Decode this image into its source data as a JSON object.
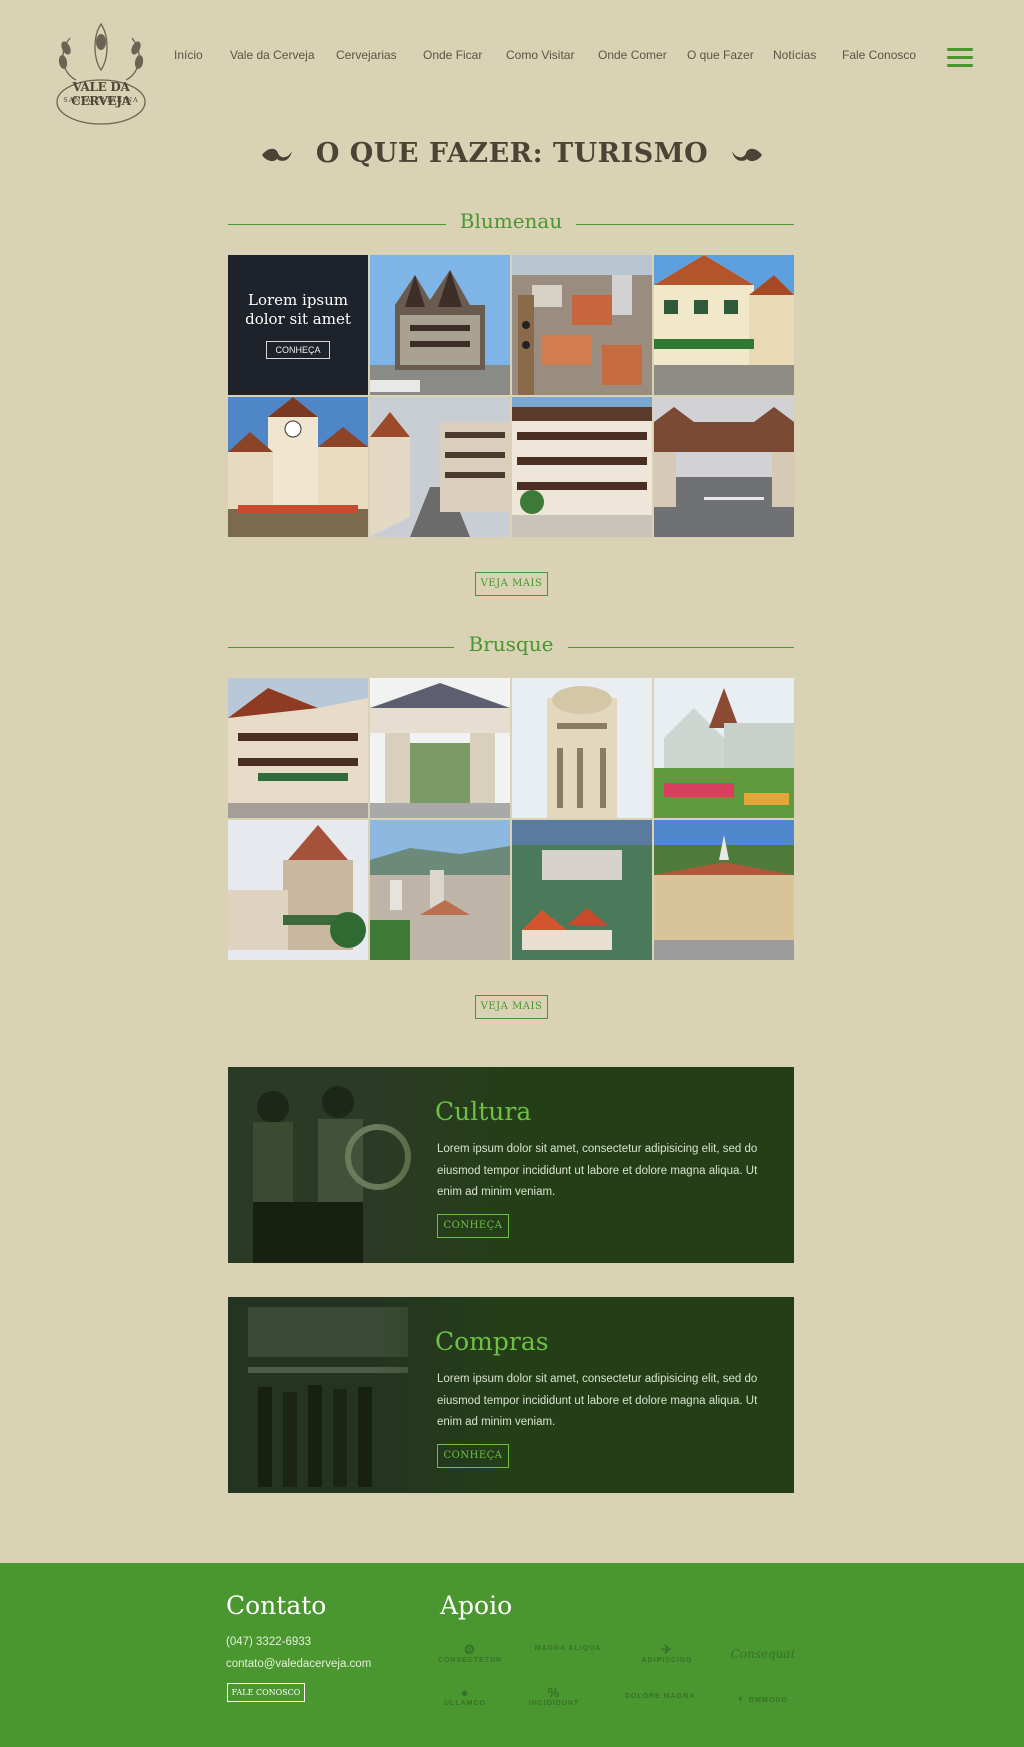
{
  "brand": {
    "logo_line1": "VALE DA CERVEJA",
    "logo_line2": "SANTA CATARINA"
  },
  "nav": [
    {
      "label": "Início"
    },
    {
      "label": "Vale da Cerveja"
    },
    {
      "label": "Cervejarias"
    },
    {
      "label": "Onde Ficar"
    },
    {
      "label": "Como Visitar"
    },
    {
      "label": "Onde Comer"
    },
    {
      "label": "O que Fazer"
    },
    {
      "label": "Notícias"
    },
    {
      "label": "Fale Conosco"
    }
  ],
  "page_title": "O QUE FAZER: TURISMO",
  "sections": [
    {
      "title": "Blumenau",
      "more_label": "VEJA MAIS",
      "overlay": {
        "text": "Lorem ipsum dolor sit amet",
        "button": "CONHEÇA"
      }
    },
    {
      "title": "Brusque",
      "more_label": "VEJA MAIS"
    }
  ],
  "panels": [
    {
      "title": "Cultura",
      "text": "Lorem ipsum dolor sit amet, consectetur adipisicing elit, sed do eiusmod tempor incididunt ut labore et dolore magna aliqua. Ut enim ad minim veniam.",
      "button": "CONHEÇA"
    },
    {
      "title": "Compras",
      "text": "Lorem ipsum dolor sit amet, consectetur adipisicing elit, sed do eiusmod tempor incididunt ut labore et dolore magna aliqua. Ut enim ad minim veniam.",
      "button": "CONHEÇA"
    }
  ],
  "footer": {
    "contact_title": "Contato",
    "phone": "(047) 3322-6933",
    "email": "contato@valedacerveja.com",
    "contact_button": "FALE CONOSCO",
    "support_title": "Apoio",
    "sponsors": [
      "CONSECTETUR",
      "MAGNA ALIQUA",
      "ADIPISCING",
      "Consequat",
      "ULLAMCO",
      "INCIDIDUNT",
      "DOLORE MAGNA",
      "OMMODO"
    ]
  },
  "colors": {
    "background": "#d9d2b4",
    "accent": "#4a962f",
    "panel": "#243f18",
    "text": "#4a4436"
  }
}
